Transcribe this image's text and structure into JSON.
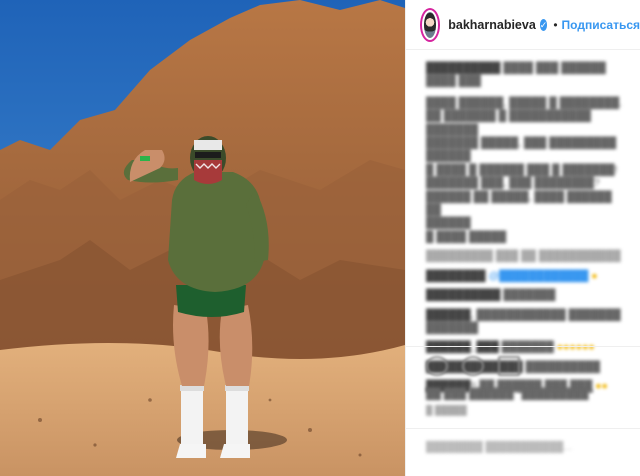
{
  "post": {
    "username": "bakharnabieva",
    "verified_mark": "✓",
    "separator": "•",
    "follow_label": "Подписаться"
  },
  "icons": {
    "verified": "verified-badge-icon",
    "like": "heart-icon",
    "comment": "comment-icon",
    "share": "share-icon"
  },
  "colors": {
    "accent": "#3897f0",
    "text": "#262626",
    "border": "#efefef",
    "sky": "#2f78c9",
    "rock": "#a3673f",
    "sand": "#d9a574"
  }
}
